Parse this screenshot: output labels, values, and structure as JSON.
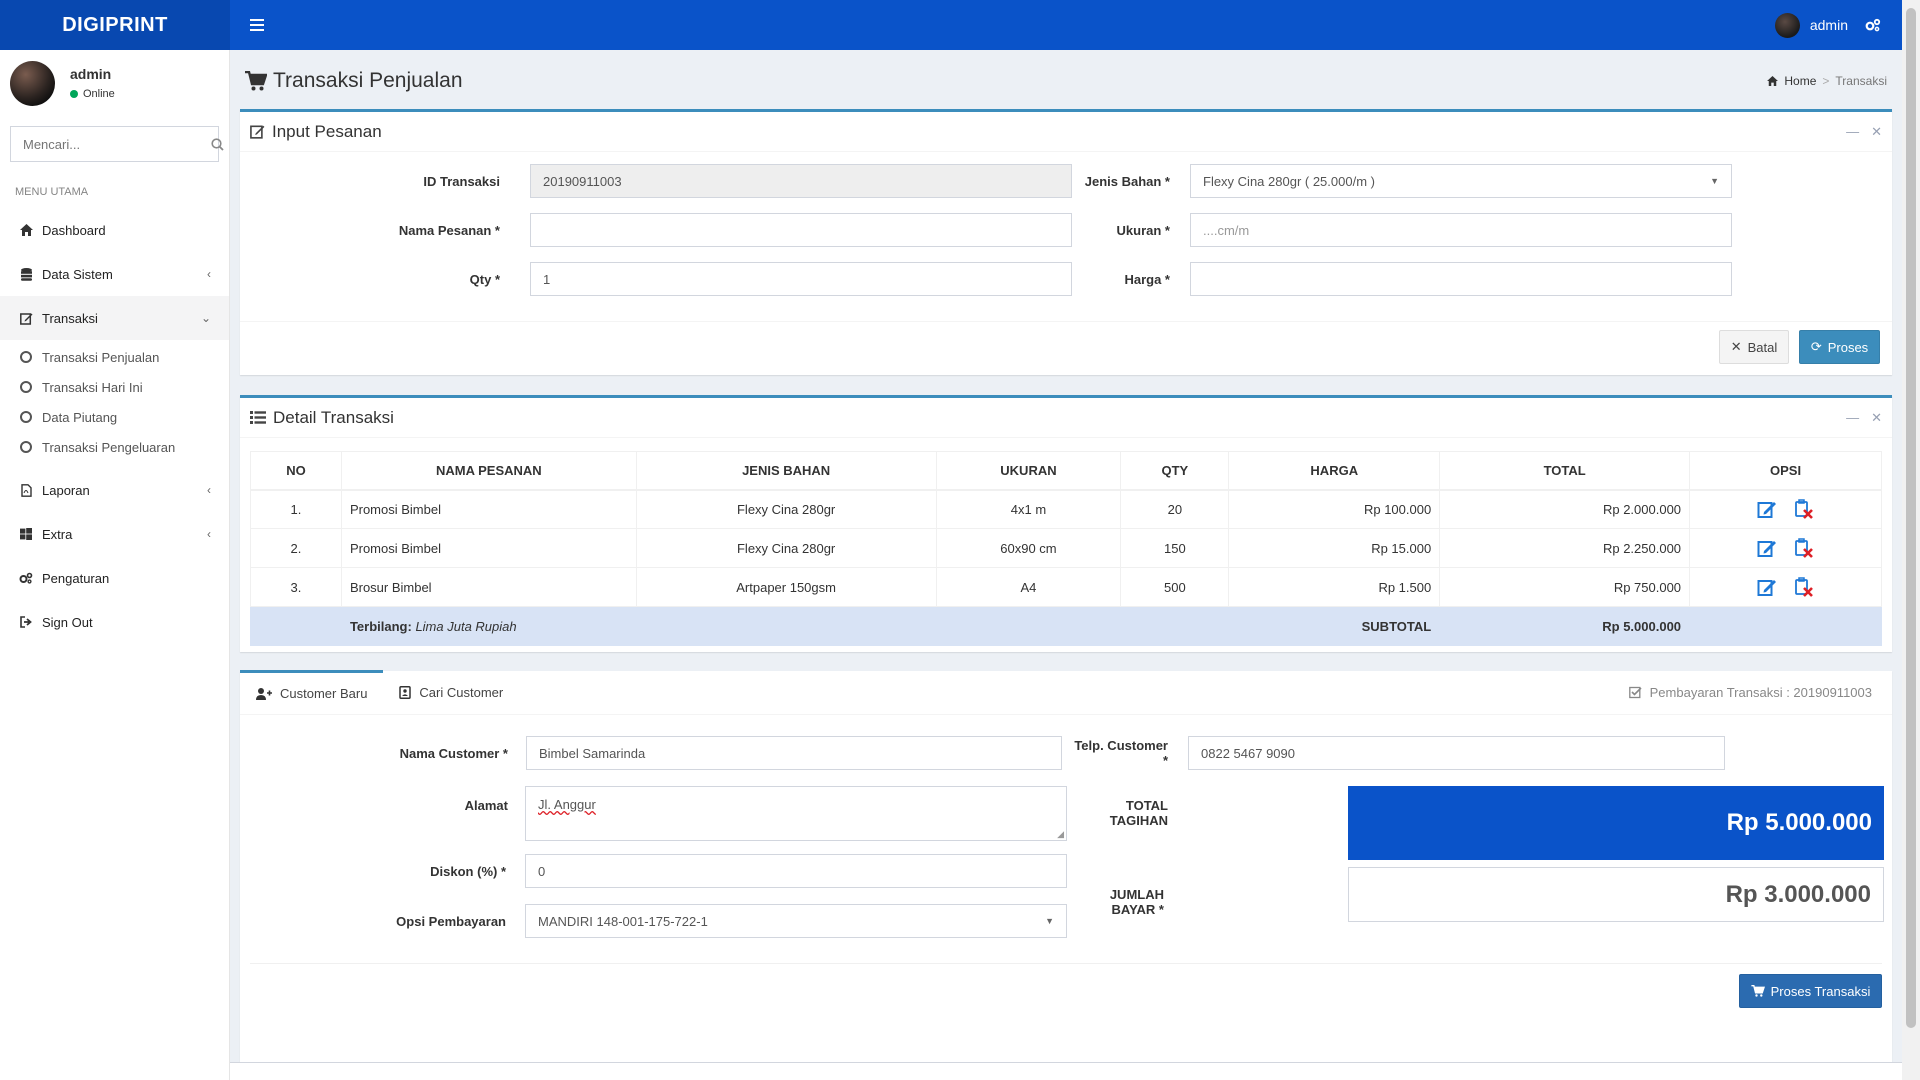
{
  "app": {
    "logo": "DIGIPRINT",
    "user": "admin"
  },
  "sidebar": {
    "user_name": "admin",
    "user_status": "Online",
    "search_placeholder": "Mencari...",
    "menu_header": "MENU UTAMA",
    "items": {
      "dashboard": "Dashboard",
      "data_sistem": "Data Sistem",
      "transaksi": "Transaksi",
      "laporan": "Laporan",
      "extra": "Extra",
      "pengaturan": "Pengaturan",
      "sign_out": "Sign Out"
    },
    "submenu": [
      "Transaksi Penjualan",
      "Transaksi Hari Ini",
      "Data Piutang",
      "Transaksi Pengeluaran"
    ]
  },
  "page": {
    "title": "Transaksi Penjualan",
    "breadcrumb_home": "Home",
    "breadcrumb_current": "Transaksi"
  },
  "input_pesanan": {
    "title": "Input Pesanan",
    "id_label": "ID Transaksi",
    "id_value": "20190911003",
    "nama_label": "Nama Pesanan *",
    "qty_label": "Qty *",
    "qty_value": "1",
    "bahan_label": "Jenis Bahan *",
    "bahan_value": "Flexy Cina 280gr ( 25.000/m )",
    "ukuran_label": "Ukuran *",
    "ukuran_placeholder": "....cm/m",
    "harga_label": "Harga *",
    "btn_batal": "Batal",
    "btn_proses": "Proses"
  },
  "detail": {
    "title": "Detail Transaksi",
    "headers": [
      "NO",
      "NAMA PESANAN",
      "JENIS BAHAN",
      "UKURAN",
      "QTY",
      "HARGA",
      "TOTAL",
      "OPSI"
    ],
    "rows": [
      {
        "no": "1.",
        "nama": "Promosi Bimbel",
        "bahan": "Flexy Cina 280gr",
        "ukuran": "4x1 m",
        "qty": "20",
        "harga": "Rp 100.000",
        "total": "Rp 2.000.000"
      },
      {
        "no": "2.",
        "nama": "Promosi Bimbel",
        "bahan": "Flexy Cina 280gr",
        "ukuran": "60x90 cm",
        "qty": "150",
        "harga": "Rp 15.000",
        "total": "Rp 2.250.000"
      },
      {
        "no": "3.",
        "nama": "Brosur Bimbel",
        "bahan": "Artpaper 150gsm",
        "ukuran": "A4",
        "qty": "500",
        "harga": "Rp 1.500",
        "total": "Rp 750.000"
      }
    ],
    "terbilang_label": "Terbilang:",
    "terbilang_value": "Lima Juta Rupiah",
    "subtotal_label": "SUBTOTAL",
    "subtotal_value": "Rp 5.000.000"
  },
  "customer": {
    "tab_baru": "Customer Baru",
    "tab_cari": "Cari Customer",
    "pembayaran": "Pembayaran Transaksi : 20190911003",
    "nama_label": "Nama Customer *",
    "nama_value": "Bimbel Samarinda",
    "alamat_label": "Alamat",
    "alamat_value": "Jl. Anggur",
    "diskon_label": "Diskon (%) *",
    "diskon_value": "0",
    "opsi_label": "Opsi Pembayaran",
    "opsi_value": "MANDIRI 148-001-175-722-1",
    "telp_label": "Telp. Customer *",
    "telp_value": "0822 5467 9090",
    "tagihan_label": "TOTAL TAGIHAN",
    "tagihan_value": "Rp 5.000.000",
    "bayar_label": "JUMLAH BAYAR *",
    "bayar_value": "Rp 3.000.000",
    "btn_proses": "Proses Transaksi"
  },
  "colors": {
    "primary": "#0a53c9",
    "accent": "#3c8dbc",
    "success": "#00a65a",
    "danger": "#dd1f26"
  }
}
